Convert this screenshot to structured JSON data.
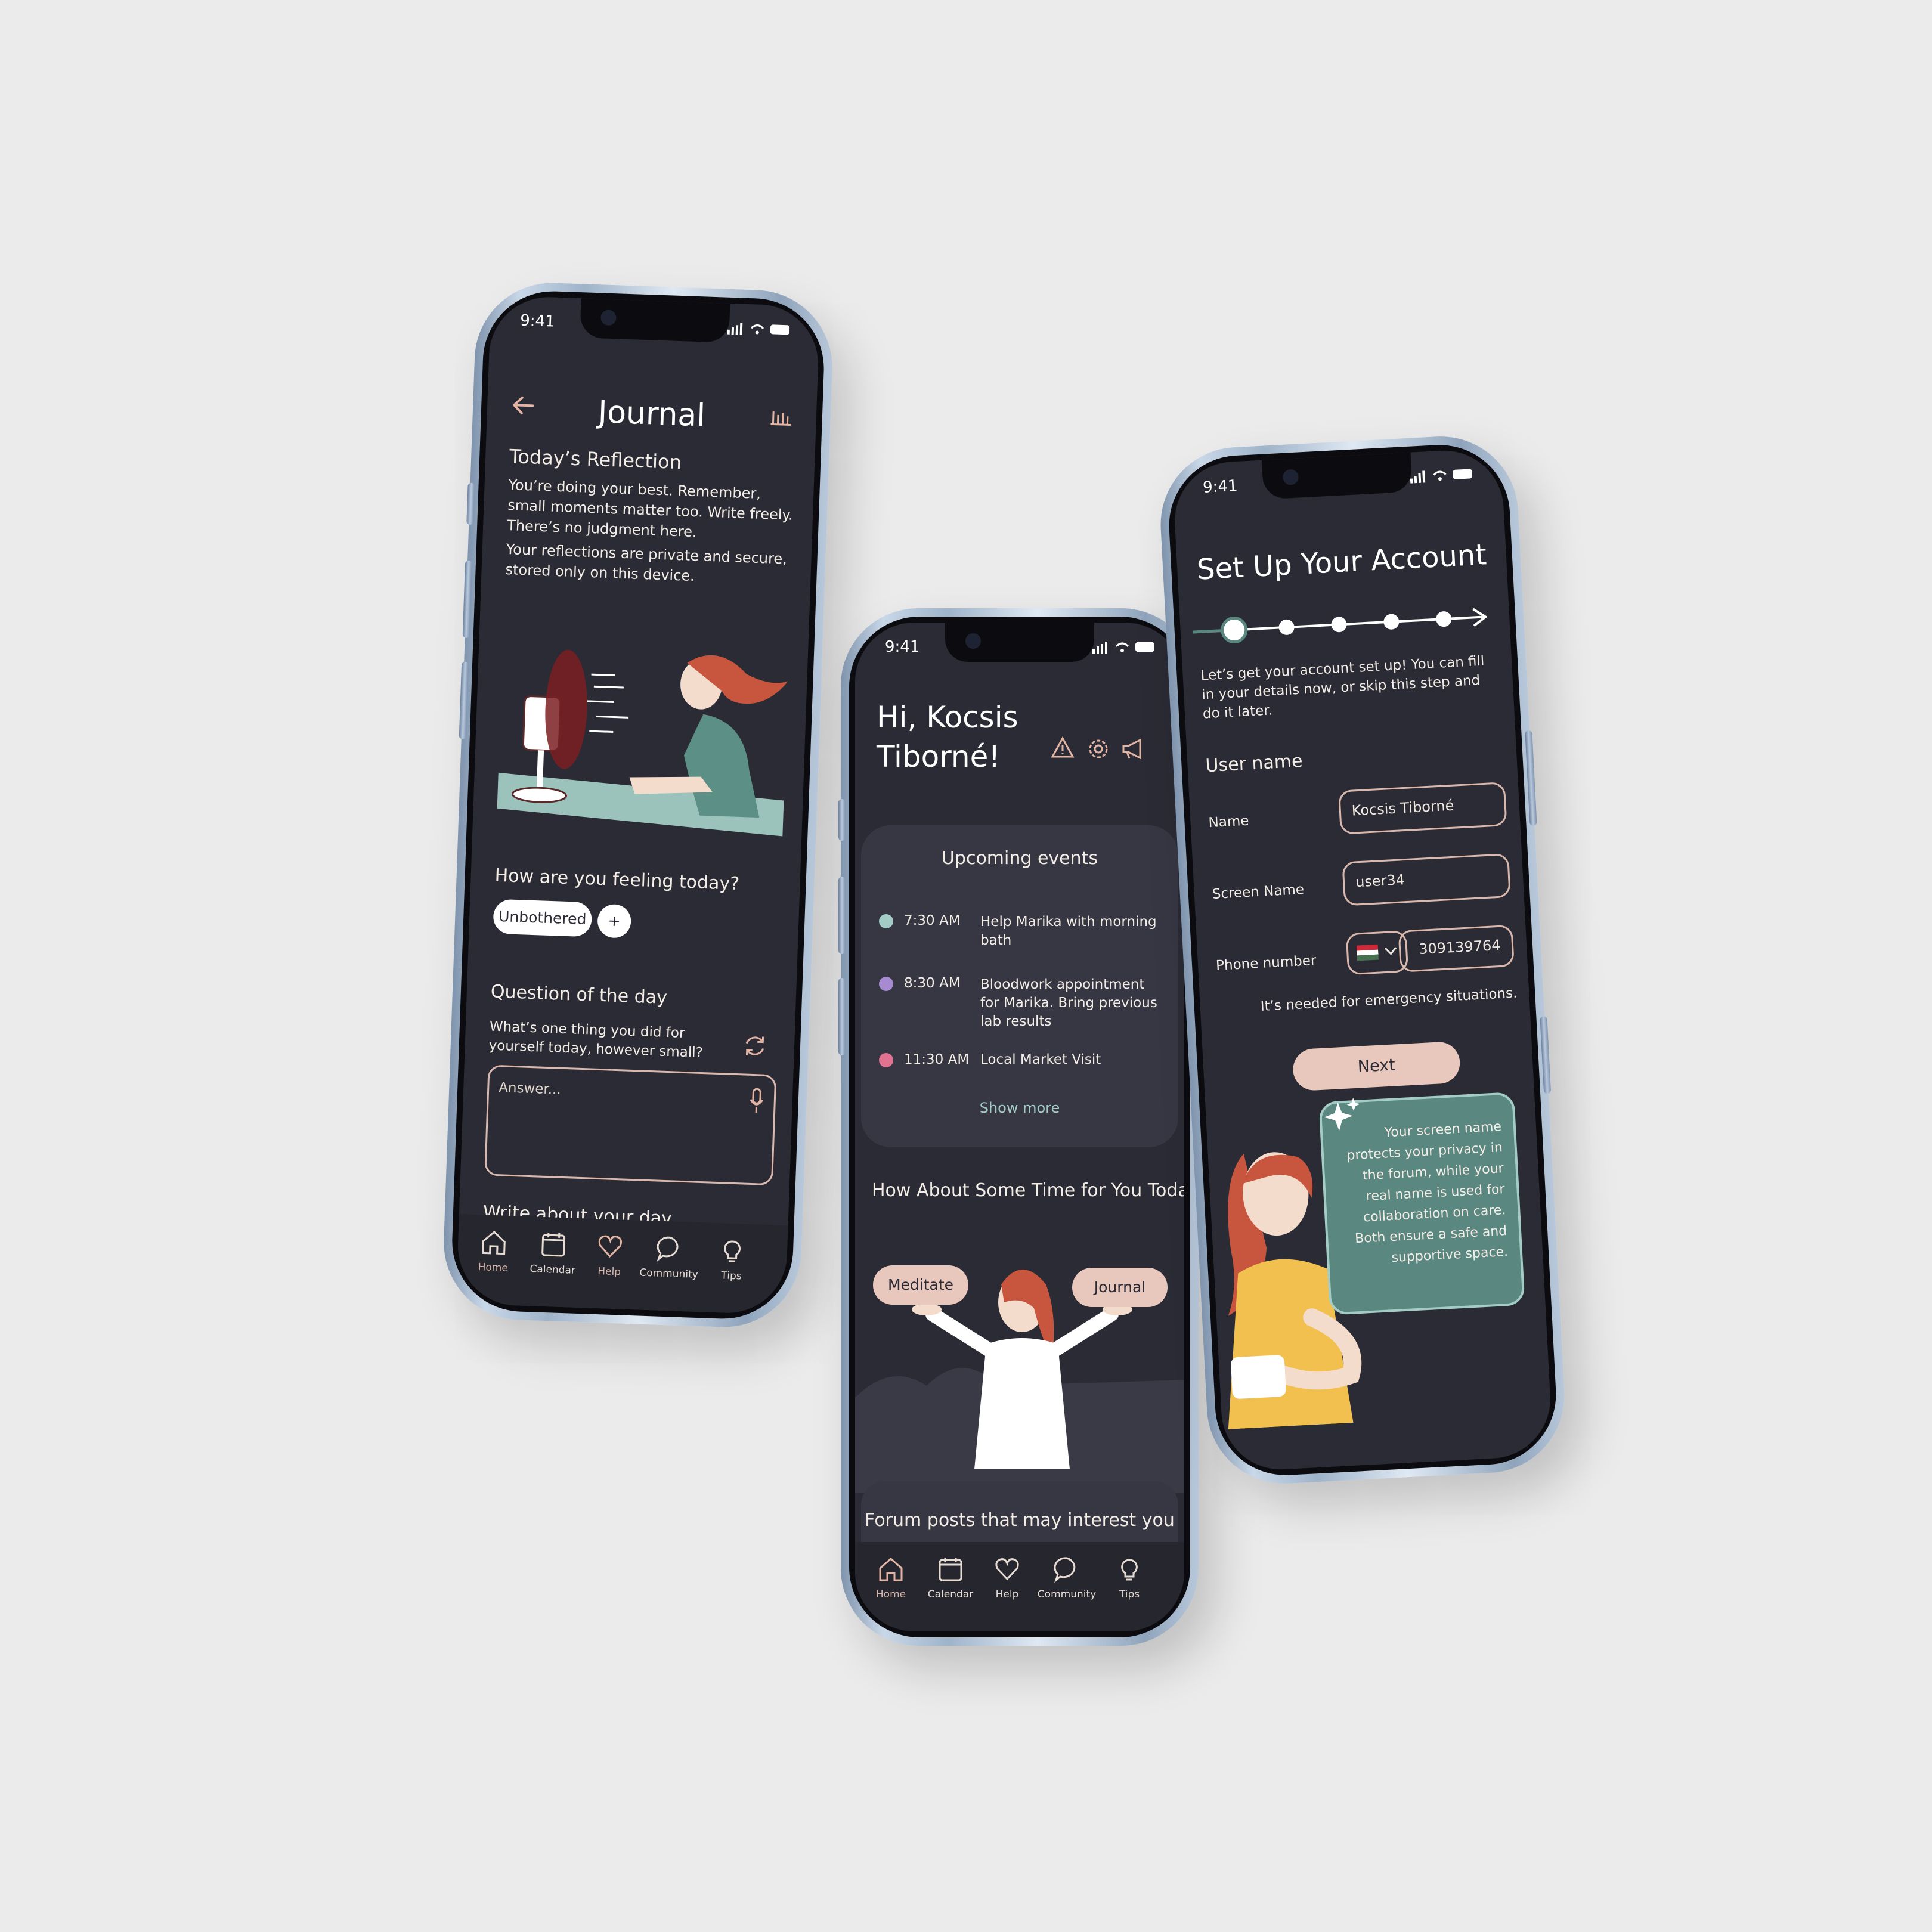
{
  "status_bar": {
    "time": "9:41"
  },
  "journal_screen": {
    "title": "Journal",
    "reflection_heading": "Today’s Reflection",
    "reflection_text": "You’re doing your best. Remember, small moments matter too. Write freely. There’s no judgment here.",
    "privacy_text": "Your reflections are private and secure, stored only on this device.",
    "feeling_heading": "How are you feeling today?",
    "mood_chip": "Unbothered",
    "add_mood": "+",
    "question_heading": "Question of the day",
    "question_text": "What’s one thing you did for yourself today, however small?",
    "answer_placeholder": "Answer...",
    "write_heading": "Write about your day"
  },
  "home_screen": {
    "greeting_line1": "Hi, Kocsis",
    "greeting_line2": "Tiborné!",
    "upcoming_title": "Upcoming events",
    "events": [
      {
        "time": "7:30 AM",
        "title": "Help Marika with morning bath",
        "color": "#a3ccc6"
      },
      {
        "time": "8:30 AM",
        "title": "Bloodwork appointment for Marika. Bring previous lab results",
        "color": "#a78bd0"
      },
      {
        "time": "11:30 AM",
        "title": "Local Market Visit",
        "color": "#e07391"
      }
    ],
    "show_more": "Show more",
    "time_for_you_heading": "How About Some Time for You Today?",
    "meditate_button": "Meditate",
    "journal_button": "Journal",
    "forum_heading": "Forum posts that may interest you"
  },
  "setup_screen": {
    "title": "Set Up Your Account",
    "intro_text": "Let’s get your account set up! You can fill in your details now, or skip this step and do it later.",
    "section_heading": "User name",
    "name_label": "Name",
    "name_value": "Kocsis Tiborné",
    "screen_name_label": "Screen Name",
    "screen_name_value": "user34",
    "phone_label": "Phone number",
    "phone_value": "309139764",
    "phone_note": "It’s needed for emergency situations.",
    "next_button": "Next",
    "tip_text": "Your screen name protects your privacy in the forum, while your real name is used for collaboration on care. Both ensure a safe and supportive space."
  },
  "nav": {
    "home": "Home",
    "calendar": "Calendar",
    "help": "Help",
    "community": "Community",
    "tips": "Tips"
  },
  "colors": {
    "background": "#ebebeb",
    "screen": "#2b2b35",
    "accent_pink": "#e8c7bd",
    "teal": "#5a8780"
  }
}
